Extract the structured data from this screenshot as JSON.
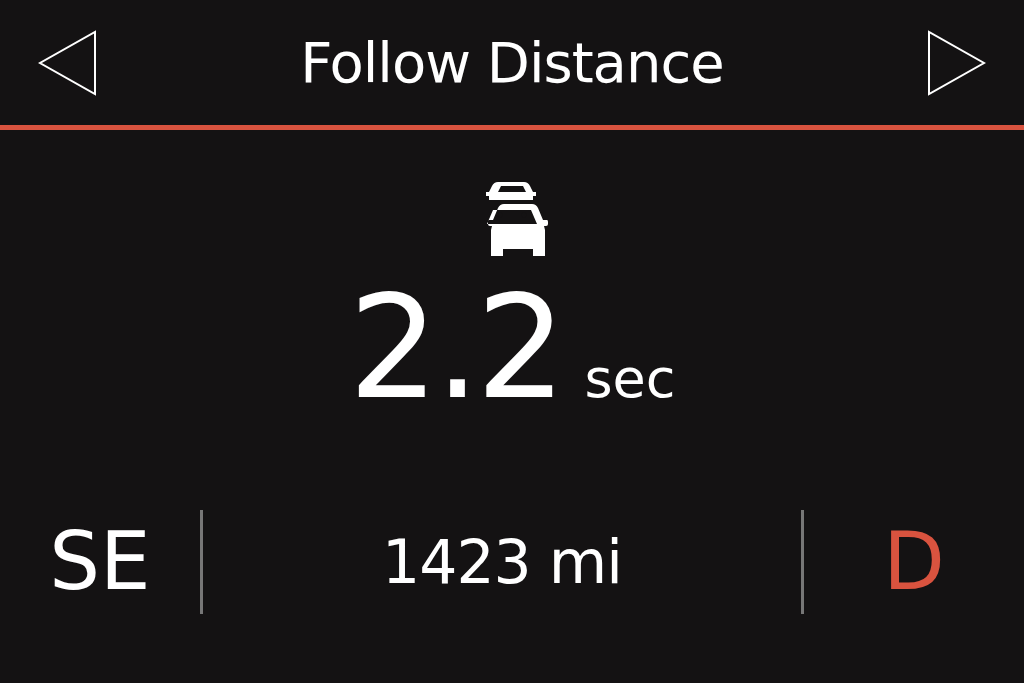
{
  "header": {
    "title": "Follow Distance"
  },
  "follow_distance": {
    "value": "2.2",
    "unit": "sec"
  },
  "status_bar": {
    "heading": "SE",
    "odometer": "1423 mi",
    "gear": "D"
  }
}
